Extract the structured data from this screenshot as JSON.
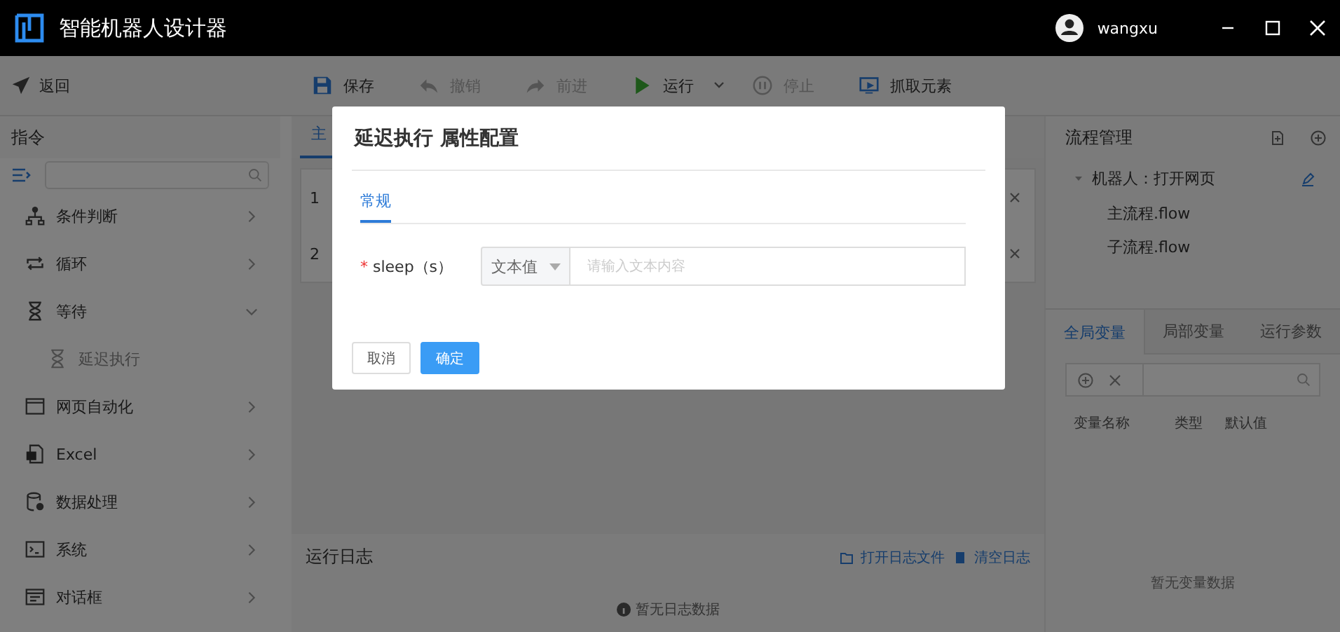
{
  "window": {
    "title": "智能机器人设计器",
    "user": "wangxu"
  },
  "toolbar": {
    "back": "返回",
    "items": [
      {
        "kind": "save",
        "label": "保存",
        "disabled": false
      },
      {
        "kind": "undo",
        "label": "撤销",
        "disabled": true
      },
      {
        "kind": "redo",
        "label": "前进",
        "disabled": true
      },
      {
        "kind": "run",
        "label": "运行",
        "disabled": false
      },
      {
        "kind": "stop",
        "label": "停止",
        "disabled": true
      },
      {
        "kind": "capture",
        "label": "抓取元素",
        "disabled": false
      }
    ]
  },
  "commands": {
    "title": "指令",
    "items": [
      {
        "kind": "condition",
        "label": "条件判断",
        "expanded": false
      },
      {
        "kind": "loop",
        "label": "循环",
        "expanded": false
      },
      {
        "kind": "wait",
        "label": "等待",
        "expanded": true,
        "children": [
          {
            "label": "延迟执行"
          }
        ]
      },
      {
        "kind": "web",
        "label": "网页自动化",
        "expanded": false
      },
      {
        "kind": "excel",
        "label": "Excel",
        "expanded": false
      },
      {
        "kind": "data",
        "label": "数据处理",
        "expanded": false
      },
      {
        "kind": "system",
        "label": "系统",
        "expanded": false
      },
      {
        "kind": "dialog",
        "label": "对话框",
        "expanded": false
      }
    ]
  },
  "editor": {
    "tab": "主",
    "rows": [
      "1",
      "2"
    ]
  },
  "log": {
    "title": "运行日志",
    "actions": [
      {
        "kind": "folder",
        "label": "打开日志文件"
      },
      {
        "kind": "clear",
        "label": "清空日志"
      }
    ],
    "empty": "暂无日志数据"
  },
  "flow": {
    "title": "流程管理",
    "tree": {
      "label": "机器人：打开网页",
      "expanded": true,
      "children": [
        {
          "label": "主流程.flow"
        },
        {
          "label": "子流程.flow"
        }
      ]
    },
    "var_tabs": [
      {
        "label": "全局变量",
        "selected": true
      },
      {
        "label": "局部变量",
        "selected": false
      },
      {
        "label": "运行参数",
        "selected": false
      }
    ],
    "columns": [
      "变量名称",
      "类型",
      "默认值"
    ],
    "empty": "暂无变量数据"
  },
  "dialog": {
    "title": "延迟执行 属性配置",
    "tabs": [
      {
        "label": "常规",
        "selected": true
      }
    ],
    "field": {
      "label": "sleep（s）",
      "required_mark": "*",
      "type": "文本值",
      "placeholder": "请输入文本内容"
    },
    "buttons": [
      {
        "kind": "cancel",
        "label": "取消"
      },
      {
        "kind": "primary",
        "label": "确定"
      }
    ]
  }
}
